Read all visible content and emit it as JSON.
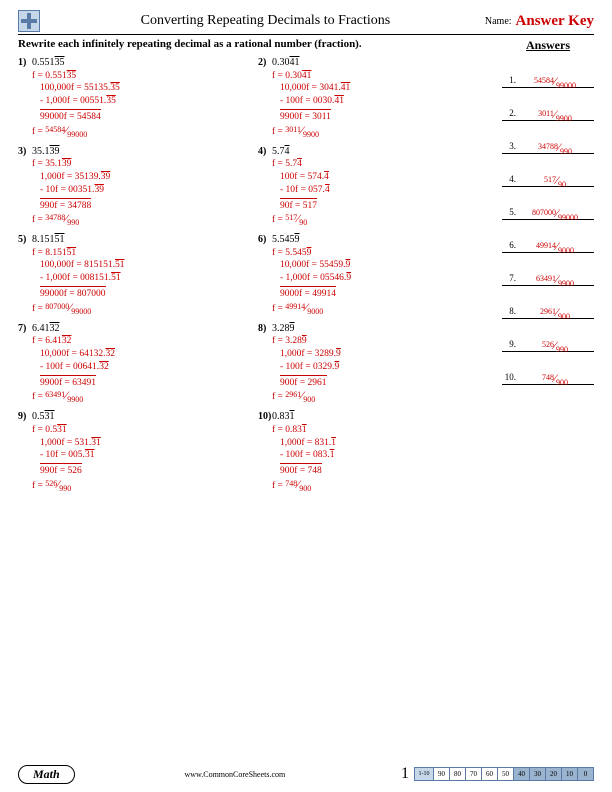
{
  "header": {
    "title": "Converting Repeating Decimals to Fractions",
    "name_label": "Name:",
    "answer_key": "Answer Key"
  },
  "instruction": "Rewrite each infinitely repeating decimal as a rational number (fraction).",
  "answers_title": "Answers",
  "answers": [
    {
      "n": "1.",
      "num": "54584",
      "den": "99000"
    },
    {
      "n": "2.",
      "num": "3011",
      "den": "9900"
    },
    {
      "n": "3.",
      "num": "34788",
      "den": "990"
    },
    {
      "n": "4.",
      "num": "517",
      "den": "90"
    },
    {
      "n": "5.",
      "num": "807000",
      "den": "99000"
    },
    {
      "n": "6.",
      "num": "49914",
      "den": "9000"
    },
    {
      "n": "7.",
      "num": "63491",
      "den": "9900"
    },
    {
      "n": "8.",
      "num": "2961",
      "den": "900"
    },
    {
      "n": "9.",
      "num": "526",
      "den": "990"
    },
    {
      "n": "10.",
      "num": "748",
      "den": "900"
    }
  ],
  "problems": [
    {
      "idx": "1)",
      "disp_pre": "0.551",
      "disp_bar": "35",
      "w1_pre": "f = 0.551",
      "w1_bar": "35",
      "w2": "100,000f = 55135.",
      "w2_bar": "35",
      "w3": "-   1,000f = 00551.",
      "w3_bar": "35",
      "w4": "99000f = 54584",
      "fn": "54584",
      "fd": "99000"
    },
    {
      "idx": "2)",
      "disp_pre": "0.30",
      "disp_bar": "41",
      "w1_pre": "f = 0.30",
      "w1_bar": "41",
      "w2": "10,000f = 3041.",
      "w2_bar": "41",
      "w3": "-    100f = 0030.",
      "w3_bar": "41",
      "w4": "9900f = 3011",
      "fn": "3011",
      "fd": "9900"
    },
    {
      "idx": "3)",
      "disp_pre": "35.1",
      "disp_bar": "39",
      "w1_pre": "f = 35.1",
      "w1_bar": "39",
      "w2": "1,000f = 35139.",
      "w2_bar": "39",
      "w3": "-    10f = 00351.",
      "w3_bar": "39",
      "w4": "990f = 34788",
      "fn": "34788",
      "fd": "990"
    },
    {
      "idx": "4)",
      "disp_pre": "5.7",
      "disp_bar": "4",
      "w1_pre": "f = 5.7",
      "w1_bar": "4",
      "w2": "100f = 574.",
      "w2_bar": "4",
      "w3": "-  10f = 057.",
      "w3_bar": "4",
      "w4": "90f = 517",
      "fn": "517",
      "fd": "90"
    },
    {
      "idx": "5)",
      "disp_pre": "8.151",
      "disp_bar": "51",
      "w1_pre": "f = 8.151",
      "w1_bar": "51",
      "w2": "100,000f = 815151.",
      "w2_bar": "51",
      "w3": "-   1,000f = 008151.",
      "w3_bar": "51",
      "w4": "99000f = 807000",
      "fn": "807000",
      "fd": "99000"
    },
    {
      "idx": "6)",
      "disp_pre": "5.545",
      "disp_bar": "9",
      "w1_pre": "f = 5.545",
      "w1_bar": "9",
      "w2": "10,000f = 55459.",
      "w2_bar": "9",
      "w3": "-  1,000f = 05546.",
      "w3_bar": "9",
      "w4": "9000f = 49914",
      "fn": "49914",
      "fd": "9000"
    },
    {
      "idx": "7)",
      "disp_pre": "6.41",
      "disp_bar": "32",
      "w1_pre": "f = 6.41",
      "w1_bar": "32",
      "w2": "10,000f = 64132.",
      "w2_bar": "32",
      "w3": "-    100f = 00641.",
      "w3_bar": "32",
      "w4": "9900f = 63491",
      "fn": "63491",
      "fd": "9900"
    },
    {
      "idx": "8)",
      "disp_pre": "3.28",
      "disp_bar": "9",
      "w1_pre": "f = 3.28",
      "w1_bar": "9",
      "w2": "1,000f = 3289.",
      "w2_bar": "9",
      "w3": "-  100f = 0329.",
      "w3_bar": "9",
      "w4": "900f = 2961",
      "fn": "2961",
      "fd": "900"
    },
    {
      "idx": "9)",
      "disp_pre": "0.5",
      "disp_bar": "31",
      "w1_pre": "f = 0.5",
      "w1_bar": "31",
      "w2": "1,000f = 531.",
      "w2_bar": "31",
      "w3": "-    10f = 005.",
      "w3_bar": "31",
      "w4": "990f = 526",
      "fn": "526",
      "fd": "990"
    },
    {
      "idx": "10)",
      "disp_pre": "0.83",
      "disp_bar": "1",
      "w1_pre": "f = 0.83",
      "w1_bar": "1",
      "w2": "1,000f = 831.",
      "w2_bar": "1",
      "w3": "-  100f = 083.",
      "w3_bar": "1",
      "w4": "900f = 748",
      "fn": "748",
      "fd": "900"
    }
  ],
  "footer": {
    "math": "Math",
    "url": "www.CommonCoreSheets.com",
    "page": "1",
    "grade_label": "1-10",
    "grades": [
      "90",
      "80",
      "70",
      "60",
      "50",
      "40",
      "30",
      "20",
      "10",
      "0"
    ]
  }
}
